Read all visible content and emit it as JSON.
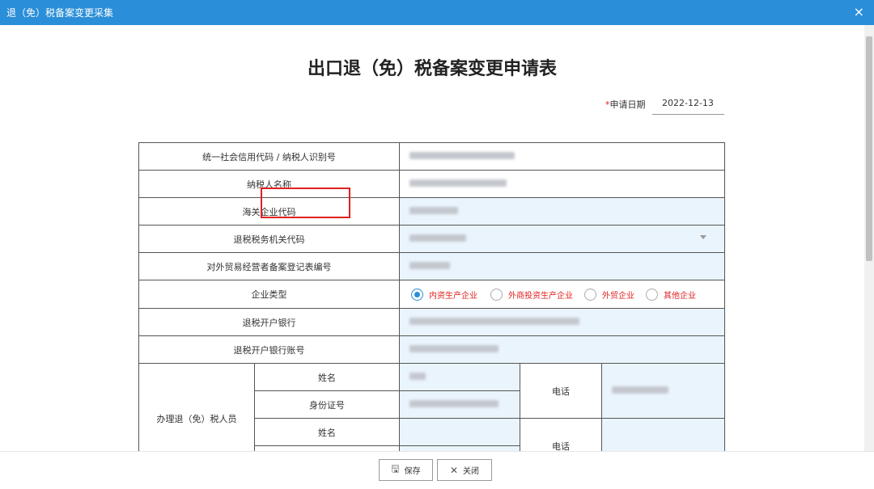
{
  "window": {
    "title": "退（免）税备案变更采集",
    "close_icon": "×"
  },
  "page": {
    "heading": "出口退（免）税备案变更申请表"
  },
  "date": {
    "required_mark": "*",
    "label": "申请日期",
    "value": "2022-12-13"
  },
  "form": {
    "rows": {
      "credit_code": "统一社会信用代码 / 纳税人识别号",
      "taxpayer_name": "纳税人名称",
      "customs_code": "海关企业代码",
      "tax_office_code": "退税税务机关代码",
      "trade_reg_no": "对外贸易经营者备案登记表编号",
      "enterprise_type": "企业类型",
      "bank": "退税开户银行",
      "bank_account": "退税开户银行账号",
      "agent_group": "办理退（免）税人员",
      "name": "姓名",
      "id_no": "身份证号",
      "phone": "电话"
    },
    "enterprise_types": [
      {
        "label": "内资生产企业",
        "checked": true
      },
      {
        "label": "外商投资生产企业",
        "checked": false
      },
      {
        "label": "外贸企业",
        "checked": false
      },
      {
        "label": "其他企业",
        "checked": false
      }
    ]
  },
  "footer": {
    "save_label": "保存",
    "close_label": "关闭",
    "save_icon": "🖫",
    "close_icon": "✕"
  }
}
